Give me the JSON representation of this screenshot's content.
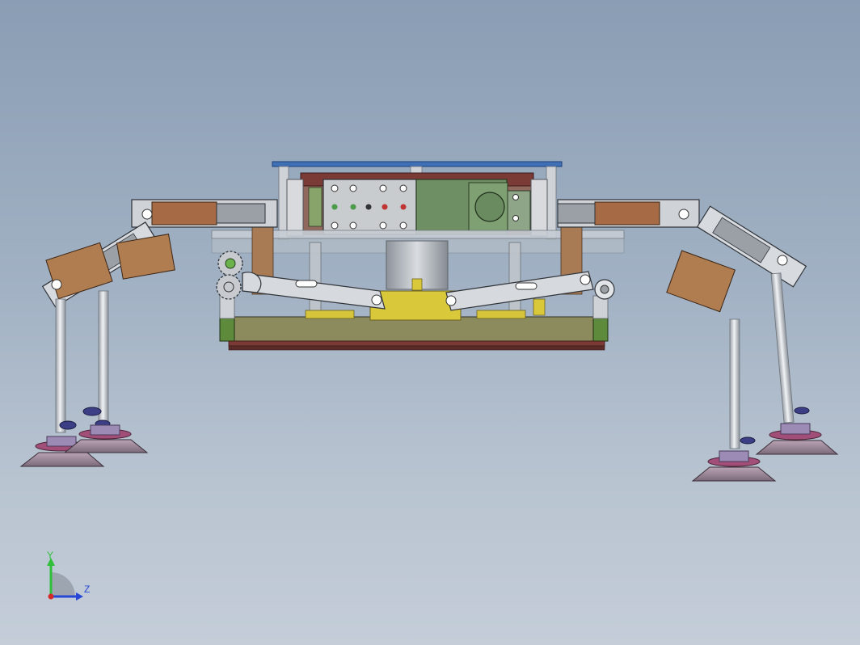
{
  "scene": {
    "model": "vacuum-suction-gripper-assembly",
    "background": {
      "top": "#8a9db4",
      "bottom": "#c4cdd8"
    },
    "colors": {
      "top_plate": "#3f6fb5",
      "frame_green": "#5e8a3c",
      "base_olive": "#8c8b5e",
      "yellow_block": "#d9c83a",
      "linkage_metal": "#d6d9dd",
      "copper_block": "#b07d50",
      "suction_pad": "#8f7d8f",
      "valve_green": "#6e8f63",
      "dark_red_plate": "#7a3a36"
    }
  },
  "triad": {
    "y_label": "Y",
    "z_label": "Z",
    "y_color": "#2fbf3a",
    "z_color": "#2747d6",
    "x_color": "#d52a2a"
  }
}
